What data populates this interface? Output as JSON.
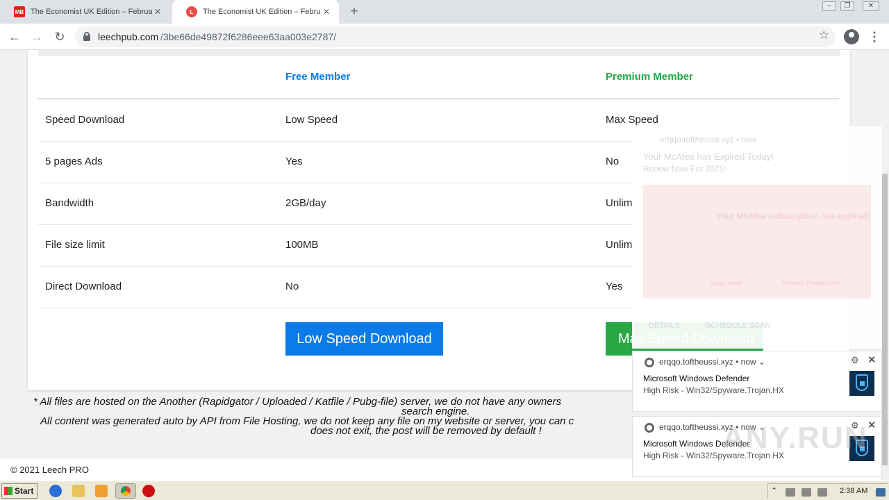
{
  "browser": {
    "tabs": [
      {
        "label": "The Economist UK Edition – February",
        "favicon": "MB",
        "active": false
      },
      {
        "label": "The Economist UK Edition – February",
        "favicon": "L",
        "active": true
      }
    ],
    "new_tab_symbol": "+",
    "url_host": "leechpub.com",
    "url_path": "/3be66de49872f6286eee63aa003e2787/"
  },
  "table": {
    "columns": [
      "",
      "Free Member",
      "Premium Member"
    ],
    "header_colors": {
      "free": "#0b7be8",
      "premium": "#28a745"
    },
    "rows": [
      {
        "feature": "Speed Download",
        "free": "Low Speed",
        "premium": "Max Speed"
      },
      {
        "feature": "5 pages Ads",
        "free": "Yes",
        "premium": "No"
      },
      {
        "feature": "Bandwidth",
        "free": "2GB/day",
        "premium": "Unlim"
      },
      {
        "feature": "File size limit",
        "free": "100MB",
        "premium": "Unlim"
      },
      {
        "feature": "Direct Download",
        "free": "No",
        "premium": "Yes"
      }
    ]
  },
  "buttons": {
    "low": "Low Speed Download",
    "max": "Max Speed Download"
  },
  "notes": {
    "line1": "* All files are hosted on the Another (Rapidgator / Uploaded / Katfile / Pubg-file) server, we do not have any owners",
    "line1b": "search engine.",
    "line2": "All content was generated auto by API from File Hosting, we do not keep any file on my website or server, you can c",
    "line3": "does not exit, the post will be removed by default !"
  },
  "footer": {
    "copyright": "© 2021 Leech PRO"
  },
  "ghost_notification": {
    "origin": "erqqo.toftheussi.xyz • now",
    "title": "Your McAfee has Expired Today!",
    "msg": "Renew Now For 2021!",
    "image_title": "Your McAfee subscription has expired!",
    "actions": [
      "DETAILS",
      "SCHEDULE SCAN"
    ],
    "image_buttons": [
      "Scan now",
      "Renew Protection"
    ]
  },
  "notifications": [
    {
      "origin": "erqqo.toftheussi.xyz",
      "time": "now",
      "title": "Microsoft Windows Defender",
      "message": "High Risk - Win32/Spyware.Trojan.HX"
    },
    {
      "origin": "erqqo.toftheussi.xyz",
      "time": "now",
      "title": "Microsoft Windows Defender",
      "message": "High Risk - Win32/Spyware.Trojan.HX"
    }
  ],
  "watermark": "ANY.RUN",
  "taskbar": {
    "start_label": "Start",
    "clock": "2:38 AM",
    "icons": [
      "ie-icon",
      "folder-icon",
      "media-player-icon",
      "chrome-icon",
      "opera-icon"
    ]
  }
}
